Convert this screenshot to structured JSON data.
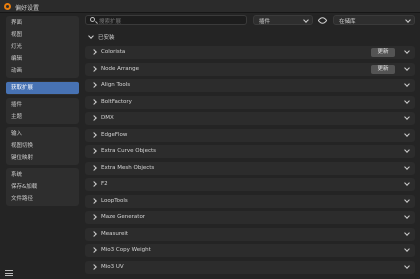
{
  "window": {
    "title": "偏好设置"
  },
  "sidebar": {
    "groups": [
      {
        "items": [
          {
            "label": "界面"
          },
          {
            "label": "视图"
          },
          {
            "label": "灯光"
          },
          {
            "label": "编辑"
          },
          {
            "label": "动画"
          }
        ]
      },
      {
        "items": [
          {
            "label": "获取扩展",
            "active": true
          }
        ]
      },
      {
        "items": [
          {
            "label": "插件"
          },
          {
            "label": "主题"
          }
        ]
      },
      {
        "items": [
          {
            "label": "输入"
          },
          {
            "label": "视图切换"
          },
          {
            "label": "键位映射"
          }
        ]
      },
      {
        "items": [
          {
            "label": "系统"
          },
          {
            "label": "保存&加载"
          },
          {
            "label": "文件路径"
          }
        ]
      }
    ]
  },
  "toolbar": {
    "search_placeholder": "搜索扩展",
    "type_filter": "插件",
    "repo_filter": "在储库"
  },
  "section": {
    "installed_label": "已安装"
  },
  "extensions": [
    {
      "name": "Colorista",
      "update_label": "更新"
    },
    {
      "name": "Node Arrange",
      "update_label": "更新"
    },
    {
      "name": "Align Tools"
    },
    {
      "name": "BoltFactory"
    },
    {
      "name": "DMX"
    },
    {
      "name": "EdgeFlow"
    },
    {
      "name": "Extra Curve Objects"
    },
    {
      "name": "Extra Mesh Objects"
    },
    {
      "name": "F2"
    },
    {
      "name": "LoopTools"
    },
    {
      "name": "Maze Generator"
    },
    {
      "name": "Measureit"
    },
    {
      "name": "Mio3 Copy Weight"
    },
    {
      "name": "Mio3 UV"
    }
  ],
  "colors": {
    "accent": "#4772b3",
    "brand": "#e87d0d"
  }
}
